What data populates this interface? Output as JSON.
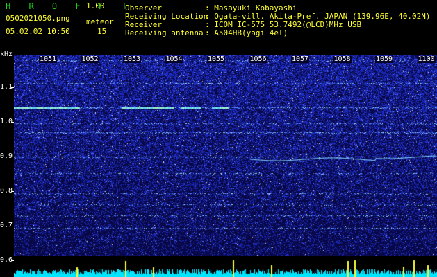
{
  "header": {
    "app_title": "H R O F F T",
    "version": "1.00",
    "filename": "0502021050.png",
    "meteor_label": "meteor",
    "meteor_count": "15",
    "datetime": "05.02.02 10:50"
  },
  "info": {
    "observer_label": "Observer",
    "observer_value": ": Masayuki Kobayashi",
    "location_label": "Receiving Location",
    "location_value": ": Ogata-vill. Akita-Pref. JAPAN (139.96E, 40.02N)",
    "receiver_label": "Receiver",
    "receiver_value": ": ICOM IC-575 53.7492(@LCD)MHz USB",
    "antenna_label": "Receiving antenna",
    "antenna_value": ": A504HB(yagi 4el)"
  },
  "spectrogram": {
    "y_unit": "kHz",
    "y_ticks": [
      "1.1",
      "1.0",
      "0.9",
      "0.8",
      "0.7",
      "0.6"
    ],
    "time_labels": [
      "1051",
      "1052",
      "1053",
      "1054",
      "1055",
      "1056",
      "1057",
      "1058",
      "1059",
      "1100"
    ],
    "colors": {
      "background": "#0a0a5a",
      "noise": "#3050ff",
      "signal": "#7fffff",
      "meter": "#00e5ff",
      "spike": "#ffff33"
    }
  }
}
